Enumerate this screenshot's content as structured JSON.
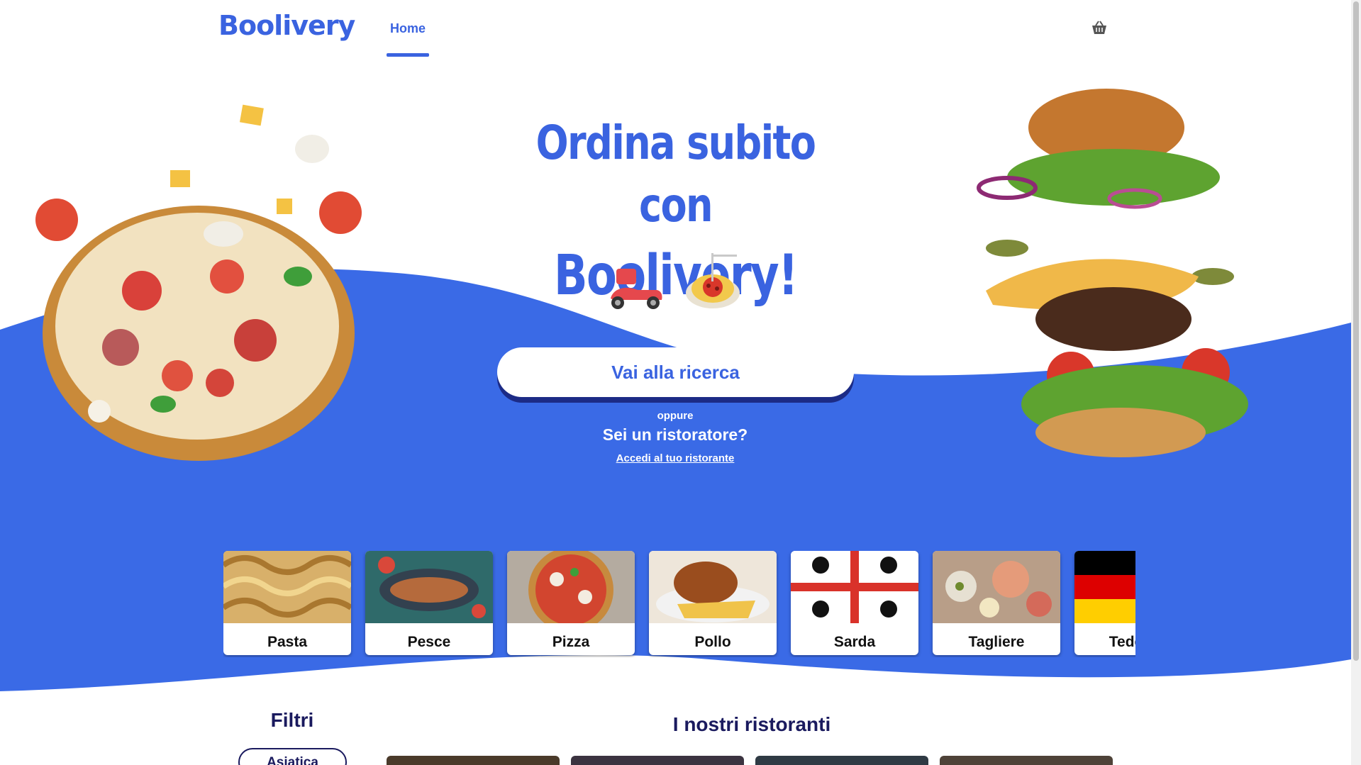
{
  "header": {
    "logo_text": "Boolivery",
    "nav_home_label": "Home",
    "cart_icon": "basket-icon"
  },
  "hero": {
    "title_line1": "Ordina subito con",
    "title_line2": "Boolivery!",
    "emojis": [
      "scooter-icon",
      "spaghetti-icon"
    ],
    "search_button_label": "Vai alla ricerca",
    "or_text": "oppure",
    "restaurateur_question": "Sei un ristoratore?",
    "restaurateur_link": "Accedi al tuo ristorante"
  },
  "categories": [
    {
      "label": "Pasta",
      "image": "pasta-image"
    },
    {
      "label": "Pesce",
      "image": "fish-image"
    },
    {
      "label": "Pizza",
      "image": "pizza-image"
    },
    {
      "label": "Pollo",
      "image": "chicken-image"
    },
    {
      "label": "Sarda",
      "image": "sardinia-flag-image"
    },
    {
      "label": "Tagliere",
      "image": "platter-image"
    },
    {
      "label": "Tedesca",
      "image": "germany-flag-image"
    }
  ],
  "filters": {
    "title": "Filtri",
    "items": [
      "Asiatica"
    ]
  },
  "restaurants": {
    "title": "I nostri ristoranti"
  },
  "colors": {
    "brand_blue": "#3a63e0",
    "dark_navy": "#1a1a5e",
    "button_shadow": "#1c2b86"
  }
}
